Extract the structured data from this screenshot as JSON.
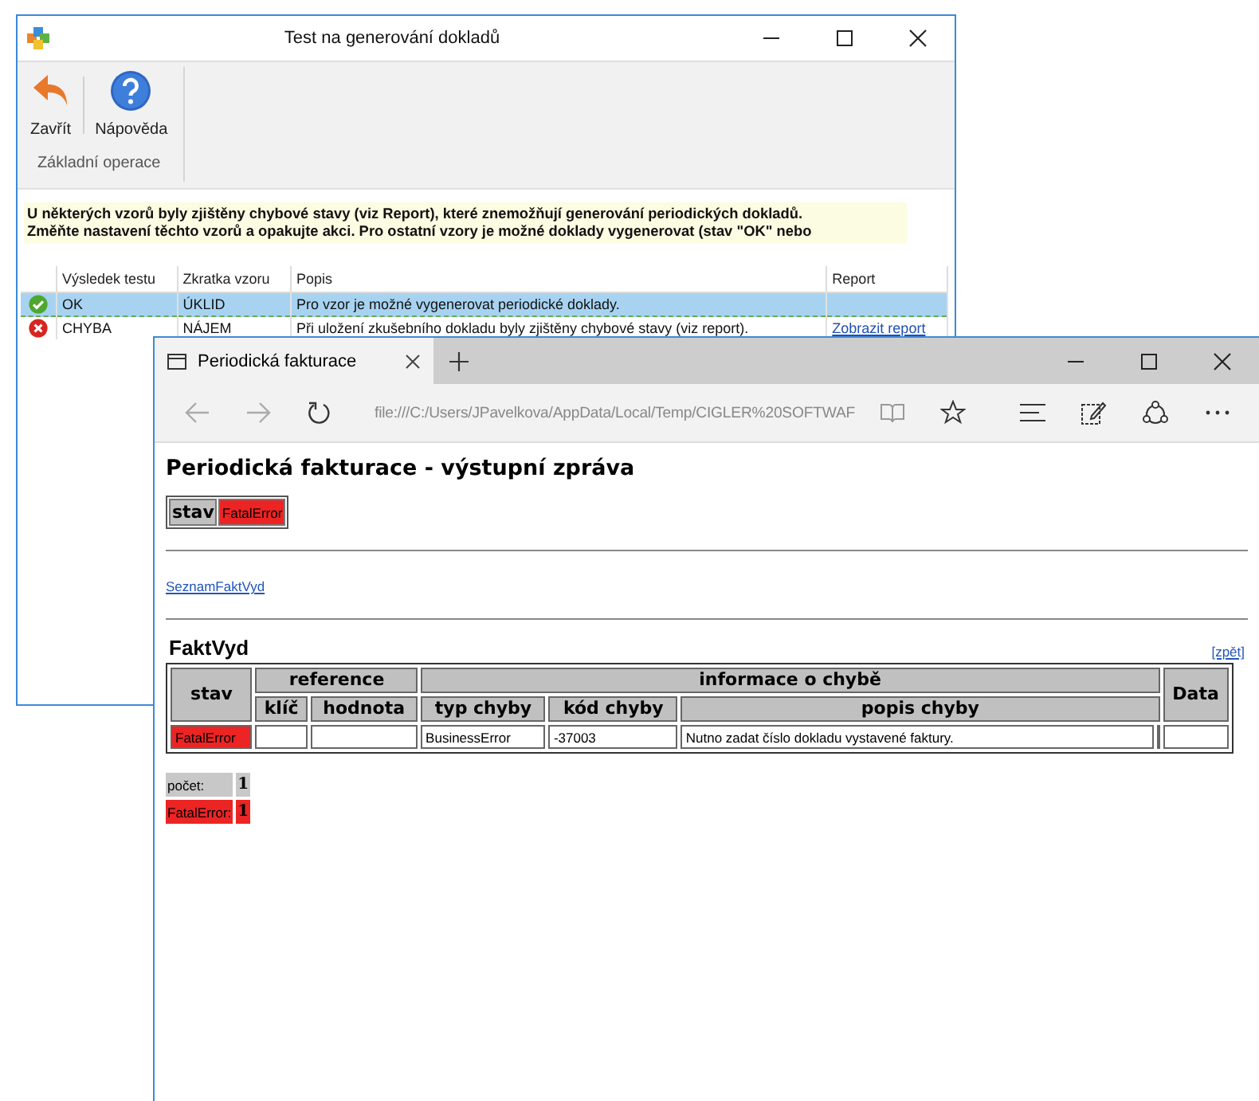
{
  "back_window": {
    "title": "Test na generování dokladů",
    "toolbar": [
      {
        "kind": "close",
        "label": "Zavřít"
      },
      {
        "kind": "help",
        "label": "Nápověda"
      }
    ],
    "group_label": "Základní operace",
    "message": [
      "U některých vzorů byly zjištěny chybové stavy (viz Report), které znemožňují generování periodických dokladů.",
      "Změňte nastavení těchto vzorů a opakujte akci. Pro ostatní vzory je možné doklady vygenerovat (stav \"OK\" nebo"
    ],
    "columns": [
      "Výsledek testu",
      "Zkratka vzoru",
      "Popis",
      "Report"
    ],
    "rows": [
      {
        "kind": "ok",
        "result": "OK",
        "code": "ÚKLID",
        "description": "Pro vzor je možné vygenerovat periodické doklady.",
        "selected": true
      },
      {
        "kind": "error",
        "result": "CHYBA",
        "code": "NÁJEM",
        "description": "Při uložení zkušebního dokladu byly zjištěny chybové stavy (viz report).",
        "report": "Zobrazit report",
        "selected": false
      }
    ]
  },
  "browser": {
    "tab_title": "Periodická fakturace",
    "address": "file:///C:/Users/JPavelkova/AppData/Local/Temp/CIGLER%20SOFTWAF",
    "page": {
      "title": "Periodická fakturace - výstupní zpráva",
      "status": {
        "label": "stav",
        "value": "FatalError"
      },
      "link": "SeznamFaktVyd",
      "section": "FaktVyd",
      "back_link": "[zpět]",
      "headers": {
        "stav": "stav",
        "reference": "reference",
        "error_info": "informace o chybě",
        "data": "Data",
        "sub": [
          "klíč",
          "hodnota",
          "typ chyby",
          "kód chyby",
          "popis chyby"
        ]
      },
      "rows": [
        {
          "stav": "FatalError",
          "type": "BusinessError",
          "code": "-37003",
          "description": "Nutno zadat číslo dokladu vystavené faktury."
        }
      ],
      "summary": [
        {
          "kind": "total",
          "label": "počet:",
          "count": "1"
        },
        {
          "kind": "error",
          "label": "FatalError:",
          "count": "1"
        }
      ]
    }
  }
}
